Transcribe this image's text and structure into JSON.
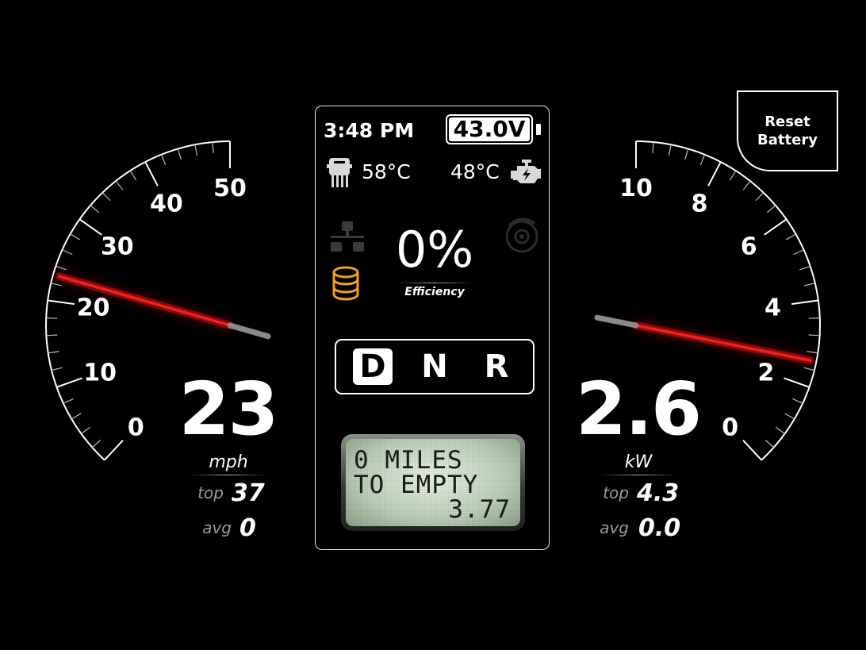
{
  "speed_gauge": {
    "value": "23",
    "unit": "mph",
    "top_label": "top",
    "top_value": "37",
    "avg_label": "avg",
    "avg_value": "0",
    "tick_labels": [
      "0",
      "10",
      "20",
      "30",
      "40",
      "50"
    ],
    "min": 0,
    "max": 50,
    "needle_value": 23
  },
  "power_gauge": {
    "value": "2.6",
    "unit": "kW",
    "top_label": "top",
    "top_value": "4.3",
    "avg_label": "avg",
    "avg_value": "0.0",
    "tick_labels": [
      "0",
      "2",
      "4",
      "6",
      "8",
      "10"
    ],
    "min": 0,
    "max": 10,
    "needle_value": 2.6
  },
  "center_panel": {
    "clock": "3:48 PM",
    "battery_voltage": "43.0V",
    "controller_temp": "58°C",
    "motor_temp": "48°C",
    "efficiency_value": "0%",
    "efficiency_label": "Efficiency",
    "gears": [
      "D",
      "N",
      "R"
    ],
    "active_gear": "D",
    "lcd_line1": "0 MILES",
    "lcd_line2": "TO EMPTY",
    "lcd_line3": "3.77"
  },
  "reset_button": {
    "line1": "Reset",
    "line2": "Battery"
  },
  "colors": {
    "background": "#000000",
    "needle": "#ff1a1a",
    "database_icon": "#f0a020",
    "dim_icon": "#3a3a3a"
  },
  "icons": [
    "controller-chip-icon",
    "engine-icon",
    "network-icon",
    "database-icon",
    "brake-disc-icon"
  ]
}
